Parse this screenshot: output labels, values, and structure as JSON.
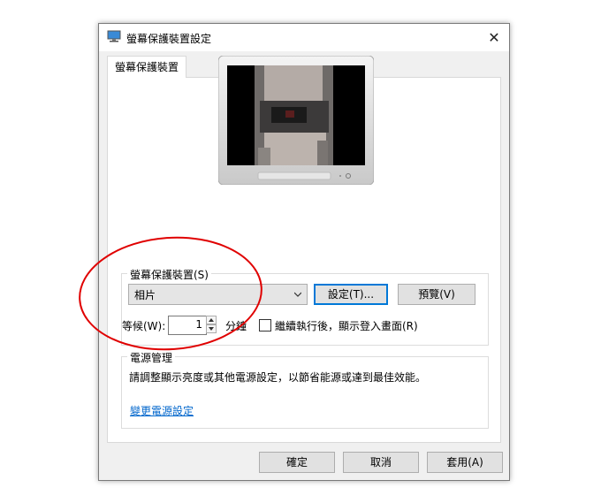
{
  "window": {
    "title": "螢幕保護裝置設定",
    "close_glyph": "✕"
  },
  "tab": {
    "label": "螢幕保護裝置"
  },
  "screensaver": {
    "group_label": "螢幕保護裝置(S)",
    "selected": "相片",
    "settings_button": "設定(T)...",
    "preview_button": "預覽(V)",
    "wait_label": "等候(W):",
    "wait_value": "1",
    "minutes_label": "分鐘",
    "resume_checkbox_label": "繼續執行後，顯示登入畫面(R)",
    "resume_checked": false
  },
  "power": {
    "group_label": "電源管理",
    "description": "請調整顯示亮度或其他電源設定，以節省能源或達到最佳效能。",
    "link": "變更電源設定"
  },
  "footer": {
    "ok": "確定",
    "cancel": "取消",
    "apply": "套用(A)"
  },
  "colors": {
    "annotation": "#e00000",
    "link": "#0066cc",
    "focus": "#0078d7"
  }
}
